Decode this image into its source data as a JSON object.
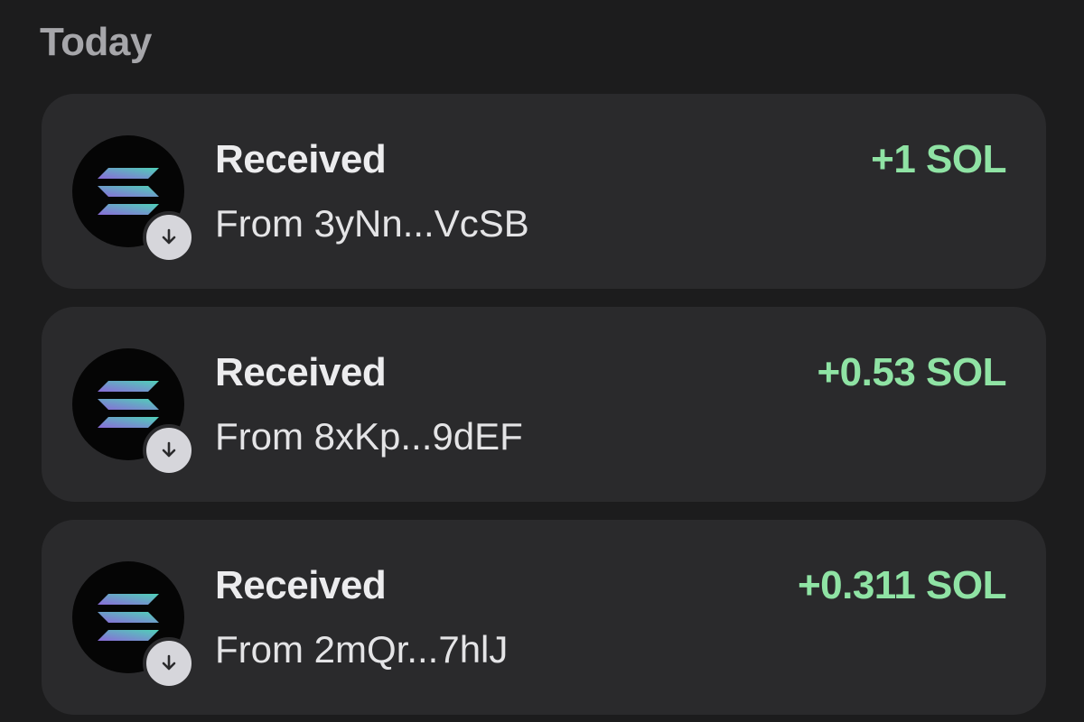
{
  "section": {
    "title": "Today"
  },
  "colors": {
    "background": "#1c1c1d",
    "card": "#2a2a2c",
    "amount_positive": "#8fe3a4",
    "logo_gradient_start": "#8a6bd8",
    "logo_gradient_end": "#4fd1b8"
  },
  "transactions": [
    {
      "title": "Received",
      "from": "From 3yNn...VcSB",
      "amount": "+1 SOL",
      "icon": "solana-logo-icon",
      "badge_icon": "arrow-down-icon"
    },
    {
      "title": "Received",
      "from": "From 8xKp...9dEF",
      "amount": "+0.53 SOL",
      "icon": "solana-logo-icon",
      "badge_icon": "arrow-down-icon"
    },
    {
      "title": "Received",
      "from": "From 2mQr...7hlJ",
      "amount": "+0.311 SOL",
      "icon": "solana-logo-icon",
      "badge_icon": "arrow-down-icon"
    }
  ]
}
